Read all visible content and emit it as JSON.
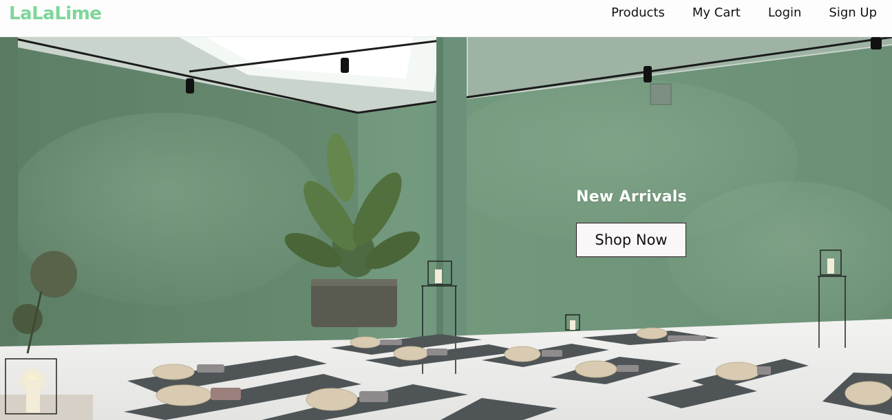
{
  "brand": {
    "name": "LaLaLime",
    "color": "#7ed69a"
  },
  "nav": {
    "items": [
      {
        "label": "Products"
      },
      {
        "label": "My Cart"
      },
      {
        "label": "Login"
      },
      {
        "label": "Sign Up"
      }
    ]
  },
  "hero": {
    "title": "New Arrivals",
    "cta_label": "Shop Now",
    "wall_color": "#6f9378",
    "floor_color": "#ececea"
  }
}
